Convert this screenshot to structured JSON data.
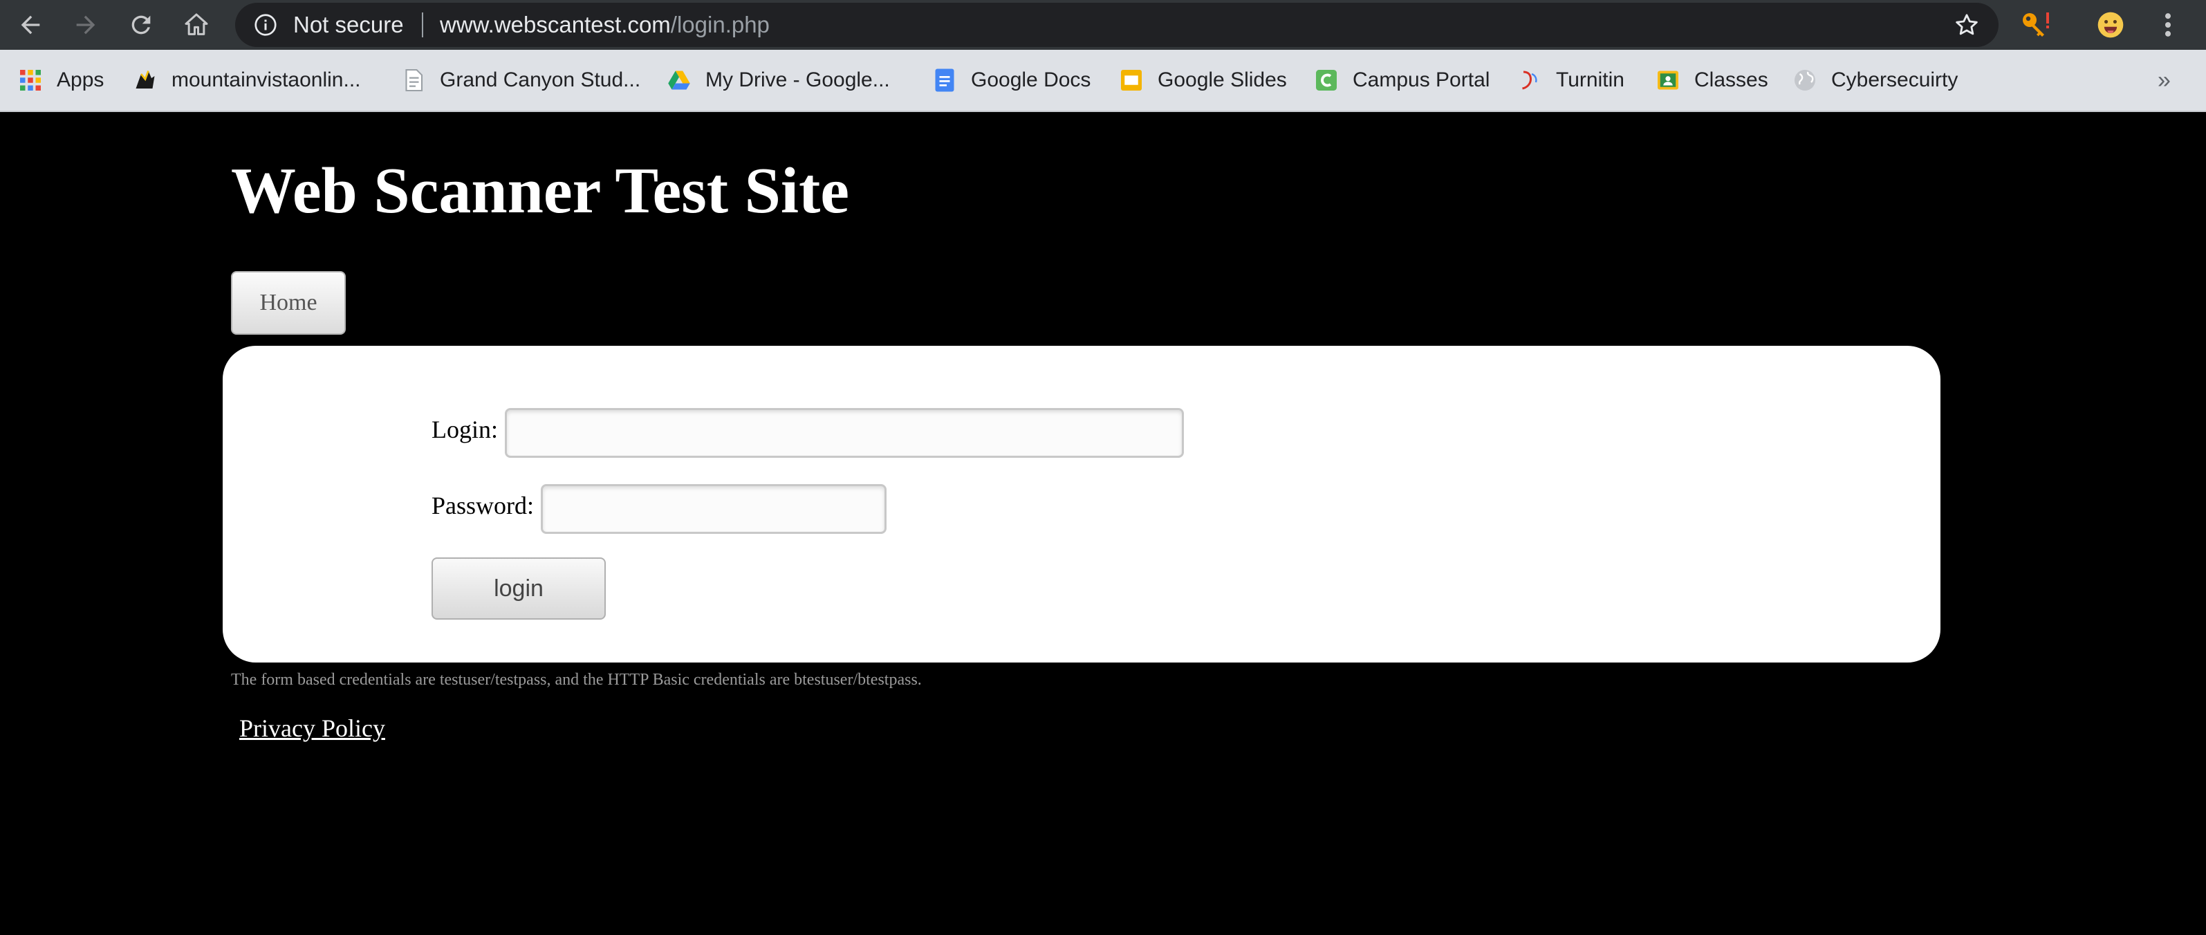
{
  "browser": {
    "security_label": "Not secure",
    "url_host": "www.webscantest.com",
    "url_path": "/login.php",
    "icons": [
      "back-icon",
      "forward-icon",
      "reload-icon",
      "home-icon",
      "info-icon",
      "star-icon",
      "key-extension-icon",
      "emoji-extension-icon",
      "menu-icon"
    ]
  },
  "bookmarks": [
    {
      "label": "Apps",
      "icon": "apps-grid-icon"
    },
    {
      "label": "mountainvistaonlin...",
      "icon": "mascot-icon"
    },
    {
      "label": "Grand Canyon Stud...",
      "icon": "page-icon"
    },
    {
      "label": "My Drive - Google...",
      "icon": "drive-icon",
      "color": "#1fa463"
    },
    {
      "label": "Google Docs",
      "icon": "docs-icon",
      "color": "#4285f4"
    },
    {
      "label": "Google Slides",
      "icon": "slides-icon",
      "color": "#f4b400"
    },
    {
      "label": "Campus Portal",
      "icon": "campus-icon",
      "color": "#5cb85c"
    },
    {
      "label": "Turnitin",
      "icon": "turnitin-icon",
      "color": "#d93025"
    },
    {
      "label": "Classes",
      "icon": "classroom-icon",
      "color": "#f6bb18"
    },
    {
      "label": "Cybersecuirty",
      "icon": "globe-icon"
    }
  ],
  "site": {
    "title": "Web Scanner Test Site",
    "home_label": "Home"
  },
  "login_form": {
    "login_label": "Login:",
    "login_value": "",
    "password_label": "Password:",
    "password_value": "",
    "submit_label": "login"
  },
  "footer": {
    "credentials_note": "The form based credentials are testuser/testpass, and the HTTP Basic credentials are btestuser/btestpass.",
    "privacy_link": "Privacy Policy"
  },
  "colors": {
    "chrome_toolbar": "#323639",
    "omnibox": "#202124",
    "bookmark_bar": "#dee1e6",
    "page_background": "#000000",
    "panel_background": "#ffffff"
  }
}
